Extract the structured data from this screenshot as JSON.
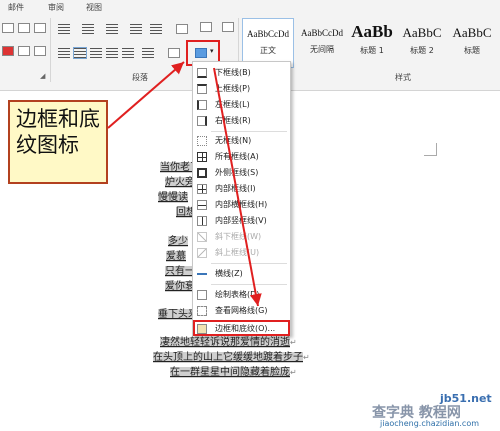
{
  "tabs": [
    "邮件",
    "审阅",
    "视图"
  ],
  "ribbon": {
    "paragraph_label": "段落",
    "styles_label": "样式",
    "styles": [
      {
        "preview": "AaBbCcDd",
        "name": "正文"
      },
      {
        "preview": "AaBbCcDd",
        "name": "无间隔"
      },
      {
        "preview": "AaBb",
        "name": "标题 1"
      },
      {
        "preview": "AaBbC",
        "name": "标题 2"
      },
      {
        "preview": "AaBbC",
        "name": "标题"
      }
    ]
  },
  "callout": {
    "text": "边框和底纹图标"
  },
  "border_menu": {
    "items": [
      {
        "label": "下框线(B)",
        "enabled": true
      },
      {
        "label": "上框线(P)",
        "enabled": true
      },
      {
        "label": "左框线(L)",
        "enabled": true
      },
      {
        "label": "右框线(R)",
        "enabled": true
      },
      {
        "label": "无框线(N)",
        "enabled": true
      },
      {
        "label": "所有框线(A)",
        "enabled": true
      },
      {
        "label": "外侧框线(S)",
        "enabled": true
      },
      {
        "label": "内部框线(I)",
        "enabled": true
      },
      {
        "label": "内部横框线(H)",
        "enabled": true
      },
      {
        "label": "内部竖框线(V)",
        "enabled": true
      },
      {
        "label": "斜下框线(W)",
        "enabled": false
      },
      {
        "label": "斜上框线(U)",
        "enabled": false
      },
      {
        "label": "横线(Z)",
        "enabled": true
      },
      {
        "label": "绘制表格(D)",
        "enabled": true
      },
      {
        "label": "查看网格线(G)",
        "enabled": true
      },
      {
        "label": "边框和底纹(O)...",
        "enabled": true
      }
    ]
  },
  "document": {
    "lines": [
      "当你老了",
      "炉火旁",
      "慢慢读",
      "回想",
      "多少",
      "爱慕",
      "只有一",
      "爱你衰",
      "垂下头来",
      "凄然地轻轻诉说那爱情的消逝",
      "在头顶上的山上它缓缓地踱着步子",
      "在一群星星中间隐藏着脸庞"
    ]
  },
  "watermark": {
    "site": "jb51.net",
    "brand": "查字典 教程网",
    "url": "jiaocheng.chazidian.com"
  },
  "colors": {
    "accent_red": "#e02020",
    "callout_bg": "#fff9c6",
    "callout_border": "#b3411f"
  }
}
